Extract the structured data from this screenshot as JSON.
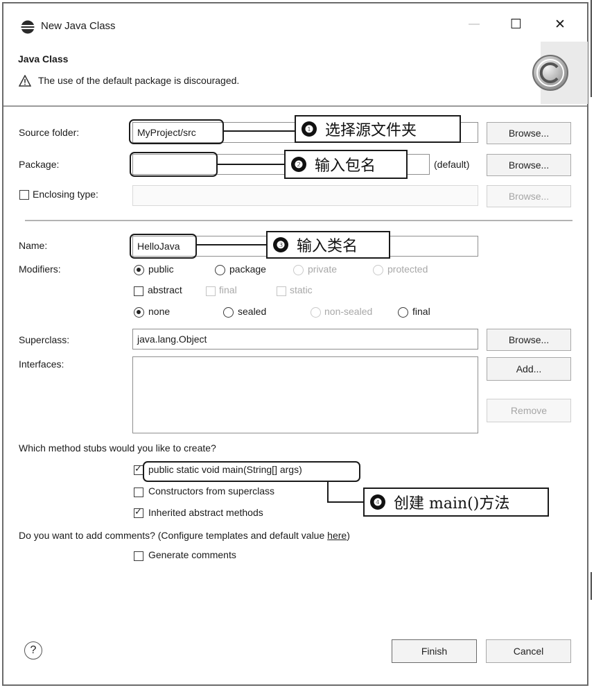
{
  "window": {
    "title": "New Java Class",
    "minimize": "—",
    "maximize": "☐",
    "close": "✕"
  },
  "header": {
    "title": "Java Class",
    "warning": "The use of the default package is discouraged."
  },
  "form": {
    "source_folder": {
      "label": "Source folder:",
      "value": "MyProject/src",
      "browse": "Browse..."
    },
    "package": {
      "label": "Package:",
      "value": "",
      "default_hint": "(default)",
      "browse": "Browse..."
    },
    "enclosing": {
      "label": "Enclosing type:",
      "value": "",
      "browse": "Browse..."
    },
    "name": {
      "label": "Name:",
      "value": "HelloJava"
    },
    "modifiers": {
      "label": "Modifiers:",
      "access": [
        "public",
        "package",
        "private",
        "protected"
      ],
      "flags": [
        "abstract",
        "final",
        "static"
      ],
      "sealing": [
        "none",
        "sealed",
        "non-sealed",
        "final"
      ]
    },
    "superclass": {
      "label": "Superclass:",
      "value": "java.lang.Object",
      "browse": "Browse..."
    },
    "interfaces": {
      "label": "Interfaces:",
      "add": "Add...",
      "remove": "Remove"
    }
  },
  "stubs": {
    "question": "Which method stubs would you like to create?",
    "main": "public static void main(String[] args)",
    "constructors": "Constructors from superclass",
    "inherited": "Inherited abstract methods"
  },
  "comments": {
    "question": "Do you want to add comments? (Configure templates and default value ",
    "link": "here",
    "close_paren": ")",
    "generate": "Generate comments"
  },
  "footer": {
    "help": "?",
    "finish": "Finish",
    "cancel": "Cancel"
  },
  "callouts": {
    "c1": {
      "num": "❶",
      "text": "选择源文件夹"
    },
    "c2": {
      "num": "❷",
      "text": "输入包名"
    },
    "c3": {
      "num": "❸",
      "text": "输入类名"
    },
    "c4": {
      "num": "❹",
      "text": "创建 main()方法"
    }
  }
}
